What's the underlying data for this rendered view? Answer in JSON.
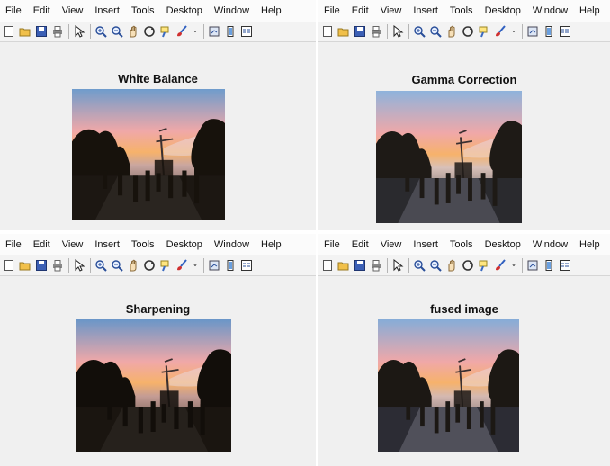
{
  "menu": [
    "File",
    "Edit",
    "View",
    "Insert",
    "Tools",
    "Desktop",
    "Window",
    "Help"
  ],
  "toolbar_icons": [
    "new-figure-icon",
    "open-file-icon",
    "save-icon",
    "print-icon",
    "select-arrow-icon",
    "zoom-in-icon",
    "zoom-out-icon",
    "pan-hand-icon",
    "rotate-3d-icon",
    "data-cursor-icon",
    "brush-icon",
    "brush-dropdown-icon",
    "link-plot-icon",
    "colorbar-icon",
    "legend-icon"
  ],
  "windows": [
    {
      "title": "White Balance",
      "image": "white-balance-photo"
    },
    {
      "title": "Gamma Correction",
      "image": "gamma-correction-photo"
    },
    {
      "title": "Sharpening",
      "image": "sharpening-photo"
    },
    {
      "title": "fused image",
      "image": "fused-photo"
    }
  ],
  "colors": {
    "window_bg": "#f0f0f0",
    "menubar_bg": "#fbfbfb",
    "sky_top": "#7fa6d4",
    "sunset_pink": "#f0a8a8",
    "sunset_orange": "#f6b26b",
    "tree_dark": "#20180f"
  }
}
